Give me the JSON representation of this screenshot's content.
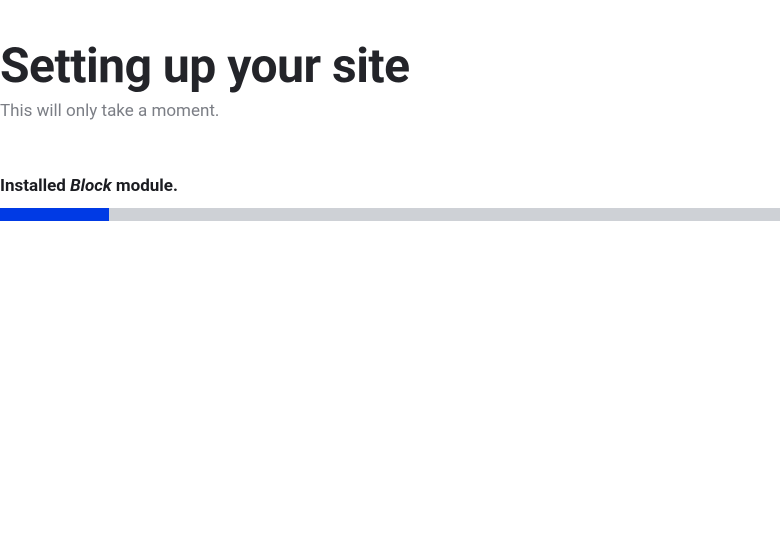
{
  "header": {
    "title": "Setting up your site",
    "subtitle": "This will only take a moment."
  },
  "progress": {
    "status_prefix": "Installed ",
    "module_name": "Block",
    "status_suffix": " module.",
    "percent": 14,
    "track_color": "#ced1d6",
    "fill_color": "#003ae5"
  }
}
